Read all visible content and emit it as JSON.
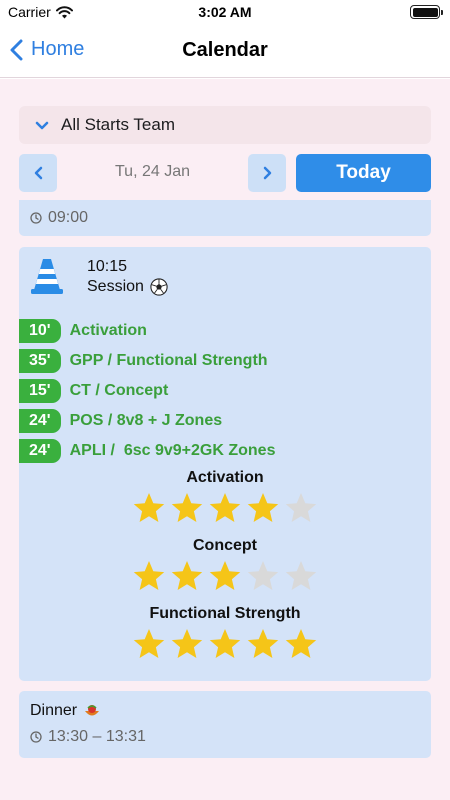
{
  "status_bar": {
    "carrier": "Carrier",
    "time": "3:02 AM"
  },
  "nav": {
    "back_label": "Home",
    "title": "Calendar"
  },
  "team": {
    "name": "All Starts Team"
  },
  "date_nav": {
    "date": "Tu, 24 Jan",
    "today_label": "Today"
  },
  "events": {
    "previous": {
      "time": "09:00"
    },
    "session": {
      "time": "10:15",
      "name": "Session",
      "activities": [
        {
          "minutes": "10'",
          "label": "Activation"
        },
        {
          "minutes": "35'",
          "label": "GPP / Functional Strength"
        },
        {
          "minutes": "15'",
          "label": "CT / Concept"
        },
        {
          "minutes": "24'",
          "label": "POS / 8v8 + J Zones"
        },
        {
          "minutes": "24'",
          "label": "APLI /  6sc 9v9+2GK Zones"
        }
      ],
      "ratings": [
        {
          "title": "Activation",
          "stars": 4,
          "max": 5
        },
        {
          "title": "Concept",
          "stars": 3,
          "max": 5
        },
        {
          "title": "Functional Strength",
          "stars": 5,
          "max": 5
        }
      ]
    },
    "dinner": {
      "title": "Dinner",
      "time_range": "13:30 – 13:31"
    }
  },
  "colors": {
    "accent": "#2f8de8",
    "card_bg": "#d4e3f8",
    "activity_green": "#3ab03e",
    "star_filled": "#f5c518",
    "star_empty": "#d9d9d9",
    "page_bg": "#fbeef4"
  },
  "icons": [
    "wifi-icon",
    "battery-icon",
    "chevron-left-icon",
    "chevron-down-icon",
    "chevron-right-icon",
    "clock-icon",
    "cone-icon",
    "soccer-ball-icon",
    "star-icon",
    "food-icon"
  ]
}
